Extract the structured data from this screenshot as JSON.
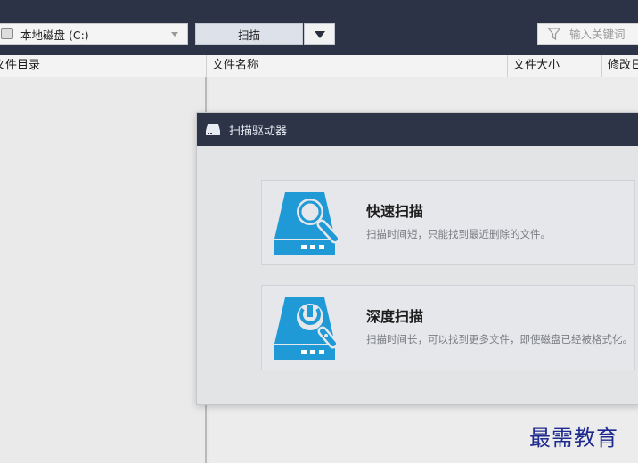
{
  "toolbar": {
    "drive_select_value": "本地磁盘 (C:)",
    "scan_button_label": "扫描",
    "search_placeholder": "输入关键词"
  },
  "left_panel": {
    "header": "文件目录"
  },
  "file_list": {
    "columns": [
      "文件名称",
      "文件大小",
      "修改日"
    ]
  },
  "dialog": {
    "title": "扫描驱动器",
    "options": [
      {
        "title": "快速扫描",
        "description": "扫描时间短，只能找到最近删除的文件。",
        "icon": "quick-scan-icon"
      },
      {
        "title": "深度扫描",
        "description": "扫描时间长，可以找到更多文件，即使磁盘已经被格式化。",
        "icon": "deep-scan-icon"
      }
    ]
  },
  "watermark": "最需教育",
  "colors": {
    "topbar": "#2c3347",
    "dialog_title": "#2d3447",
    "icon_blue": "#1f9ad6",
    "watermark": "#1f2a8f"
  }
}
